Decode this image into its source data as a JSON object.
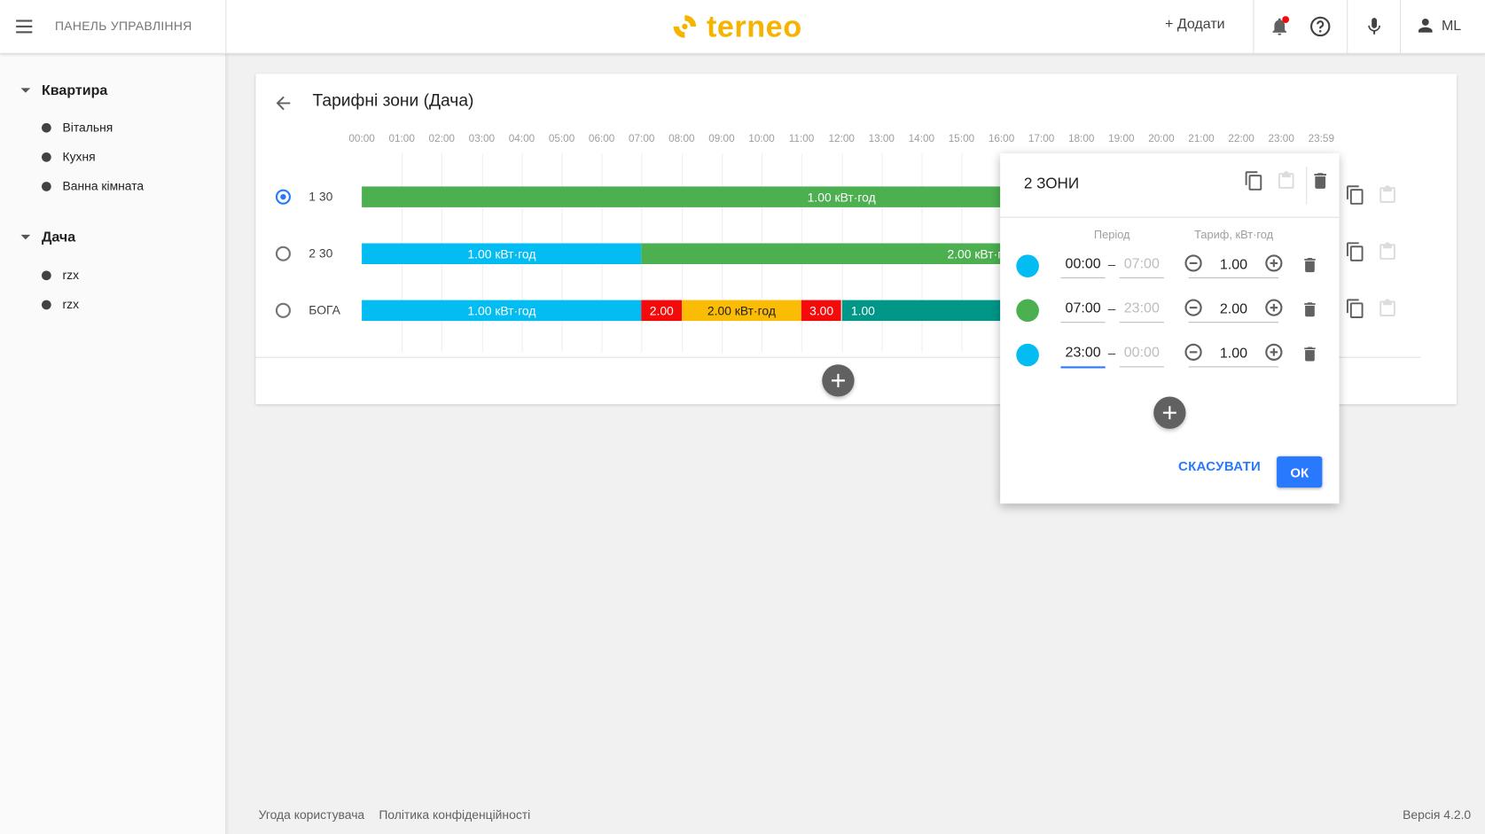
{
  "topbar": {
    "title": "ПАНЕЛЬ УПРАВЛІННЯ",
    "logo": "terneo",
    "add_label": "+ Додати",
    "user_initials": "ML",
    "icons": [
      "menu-icon",
      "bell-icon",
      "help-icon",
      "microphone-icon",
      "person-icon"
    ]
  },
  "sidebar": {
    "groups": [
      {
        "name": "Квартира",
        "rooms": [
          "Вітальня",
          "Кухня",
          "Ванна кімната"
        ]
      },
      {
        "name": "Дача",
        "rooms": [
          "rzx",
          "rzx"
        ]
      }
    ]
  },
  "page": {
    "title": "Тарифні зони (Дача)",
    "hours": [
      "00:00",
      "01:00",
      "02:00",
      "03:00",
      "04:00",
      "05:00",
      "06:00",
      "07:00",
      "08:00",
      "09:00",
      "10:00",
      "11:00",
      "12:00",
      "13:00",
      "14:00",
      "15:00",
      "16:00",
      "17:00",
      "18:00",
      "19:00",
      "20:00",
      "21:00",
      "22:00",
      "23:00",
      "23:59"
    ],
    "rows": [
      {
        "label": "1 30",
        "selected": true,
        "segments": [
          {
            "start": 0,
            "end": 24,
            "color": "#4caf50",
            "text": "1.00 кВт·год"
          }
        ]
      },
      {
        "label": "2 30",
        "selected": false,
        "segments": [
          {
            "start": 0,
            "end": 7,
            "color": "#03bdf2",
            "text": "1.00 кВт·год"
          },
          {
            "start": 7,
            "end": 24,
            "color": "#4caf50",
            "text": "2.00 кВт·год"
          }
        ]
      },
      {
        "label": "БОГА",
        "selected": false,
        "segments": [
          {
            "start": 0,
            "end": 7,
            "color": "#03bdf2",
            "text": "1.00 кВт·год"
          },
          {
            "start": 7,
            "end": 8,
            "color": "#f40a0a",
            "text": "2.00"
          },
          {
            "start": 8,
            "end": 11,
            "color": "#fbbc05",
            "text": "2.00 кВт·год"
          },
          {
            "start": 11,
            "end": 12,
            "color": "#f40a0a",
            "text": "3.00"
          },
          {
            "start": 12,
            "end": 24,
            "color": "#009688",
            "text": "1.00"
          }
        ]
      }
    ]
  },
  "popup": {
    "title": "2 ЗОНИ",
    "period_header": "Період",
    "tariff_header": "Тариф, кВт·год",
    "zones": [
      {
        "color": "#03bdf2",
        "from": "00:00",
        "to": "07:00",
        "tariff": "1.00"
      },
      {
        "color": "#4caf50",
        "from": "07:00",
        "to": "23:00",
        "tariff": "2.00"
      },
      {
        "color": "#03bdf2",
        "from": "23:00",
        "to": "00:00",
        "tariff": "1.00"
      }
    ],
    "cancel_label": "СКАСУВАТИ",
    "ok_label": "ОК"
  },
  "footer": {
    "links": [
      "Угода користувача",
      "Політика конфіденційності"
    ],
    "version": "Версія 4.2.0"
  }
}
